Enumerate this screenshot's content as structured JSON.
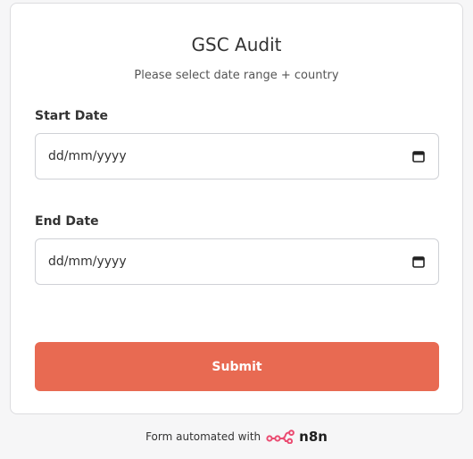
{
  "form": {
    "title": "GSC Audit",
    "subtitle": "Please select date range + country",
    "fields": [
      {
        "label": "Start Date",
        "value": "dd/mm/yyyy",
        "icon": "calendar-icon"
      },
      {
        "label": "End Date",
        "value": "dd/mm/yyyy",
        "icon": "calendar-icon"
      }
    ],
    "submit_label": "Submit"
  },
  "footer": {
    "text": "Form automated with",
    "brand": "n8n",
    "icon": "n8n-logo-icon"
  },
  "colors": {
    "accent": "#e86a52",
    "background": "#f6f6f7",
    "card": "#ffffff",
    "border": "#cfd1d6"
  }
}
